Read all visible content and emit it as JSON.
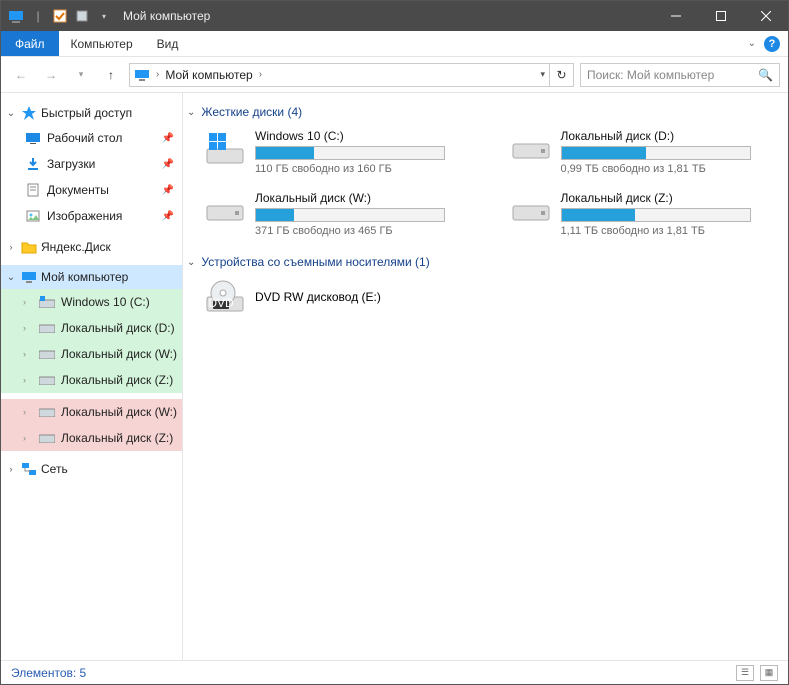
{
  "title": "Мой компьютер",
  "menu": {
    "file": "Файл",
    "computer": "Компьютер",
    "view": "Вид"
  },
  "breadcrumb": {
    "root": "Мой компьютер"
  },
  "search": {
    "placeholder": "Поиск: Мой компьютер"
  },
  "tree": {
    "quick_access": "Быстрый доступ",
    "desktop": "Рабочий стол",
    "downloads": "Загрузки",
    "documents": "Документы",
    "pictures": "Изображения",
    "yandex": "Яндекс.Диск",
    "my_computer": "Мой компьютер",
    "win10": "Windows 10 (C:)",
    "local_d": "Локальный диск (D:)",
    "local_w": "Локальный диск (W:)",
    "local_z": "Локальный диск (Z:)",
    "local_w2": "Локальный диск (W:)",
    "local_z2": "Локальный диск (Z:)",
    "network": "Сеть"
  },
  "sections": {
    "hdd": "Жесткие диски (4)",
    "removable": "Устройства со съемными носителями (1)"
  },
  "drives": {
    "c": {
      "name": "Windows 10 (C:)",
      "free": "110 ГБ свободно из 160 ГБ",
      "fill": 31
    },
    "d": {
      "name": "Локальный диск (D:)",
      "free": "0,99 ТБ свободно из 1,81 ТБ",
      "fill": 45
    },
    "w": {
      "name": "Локальный диск (W:)",
      "free": "371 ГБ свободно из 465 ГБ",
      "fill": 20
    },
    "z": {
      "name": "Локальный диск (Z:)",
      "free": "1,11 ТБ свободно из 1,81 ТБ",
      "fill": 39
    }
  },
  "removable": {
    "dvd": "DVD RW дисковод (E:)"
  },
  "status": {
    "items": "Элементов: 5"
  }
}
